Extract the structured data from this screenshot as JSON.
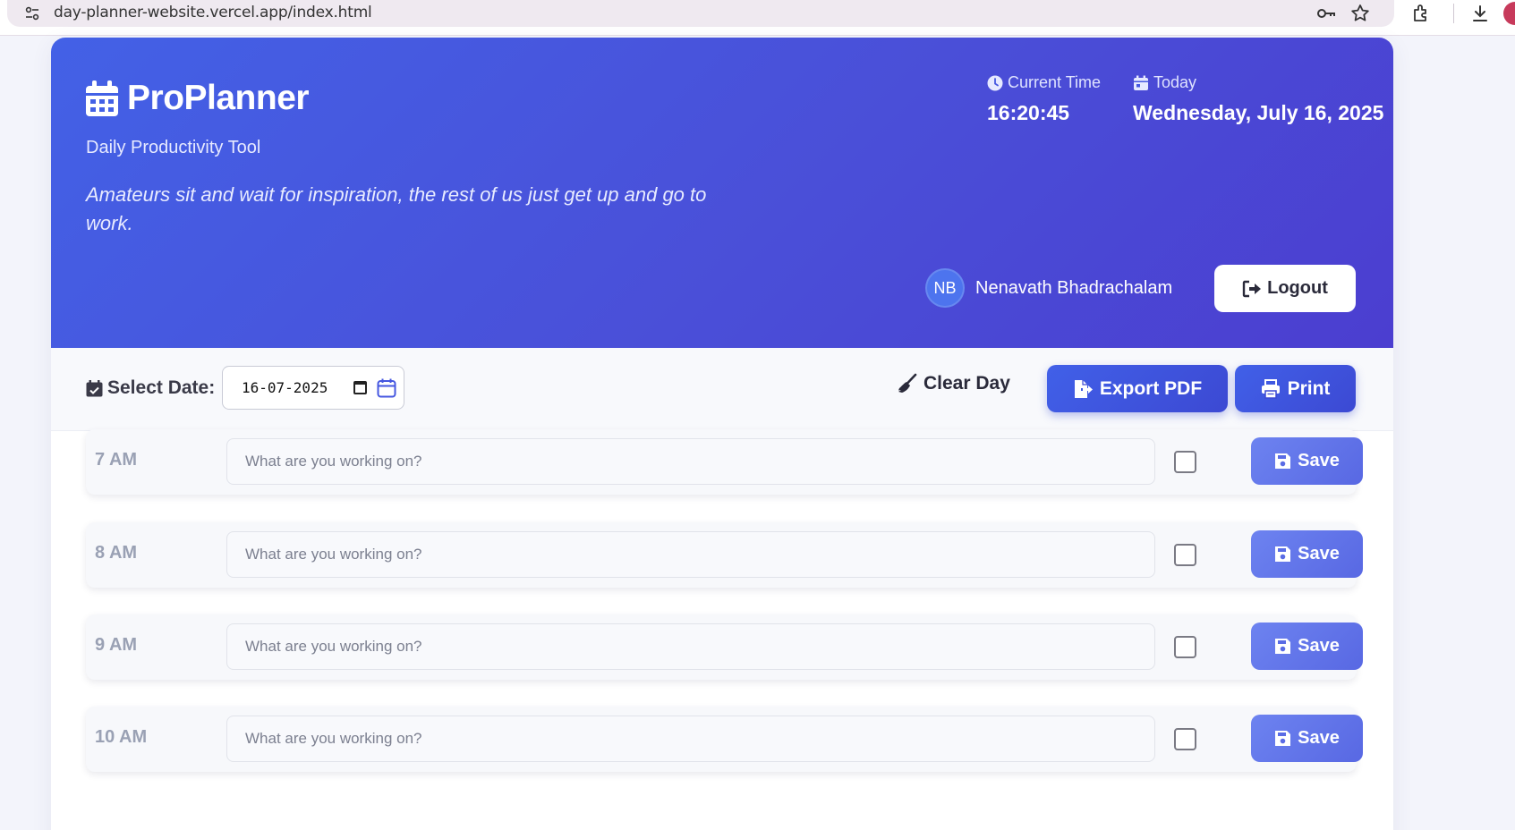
{
  "browser": {
    "url": "day-planner-website.vercel.app/index.html"
  },
  "header": {
    "app_title": "ProPlanner",
    "tagline": "Daily Productivity Tool",
    "quote": "Amateurs sit and wait for inspiration, the rest of us just get up and go to work.",
    "time_label": "Current Time",
    "time_value": "16:20:45",
    "date_label": "Today",
    "date_value": "Wednesday, July 16, 2025",
    "user_initials": "NB",
    "user_name": "Nenavath Bhadrachalam",
    "logout_label": "Logout"
  },
  "toolbar": {
    "select_date_label": "Select Date:",
    "date_value": "16-07-2025",
    "clear_label": "Clear Day",
    "export_label": "Export PDF",
    "print_label": "Print"
  },
  "schedule": {
    "placeholder": "What are you working on?",
    "save_label": "Save",
    "hours": [
      {
        "label": "7 AM",
        "value": "",
        "done": false
      },
      {
        "label": "8 AM",
        "value": "",
        "done": false
      },
      {
        "label": "9 AM",
        "value": "",
        "done": false
      },
      {
        "label": "10 AM",
        "value": "",
        "done": false
      }
    ]
  },
  "colors": {
    "hero_start": "#4361e6",
    "hero_end": "#4b3ed0",
    "primary_button": "#4160e8",
    "save_button": "#6d83f0"
  }
}
